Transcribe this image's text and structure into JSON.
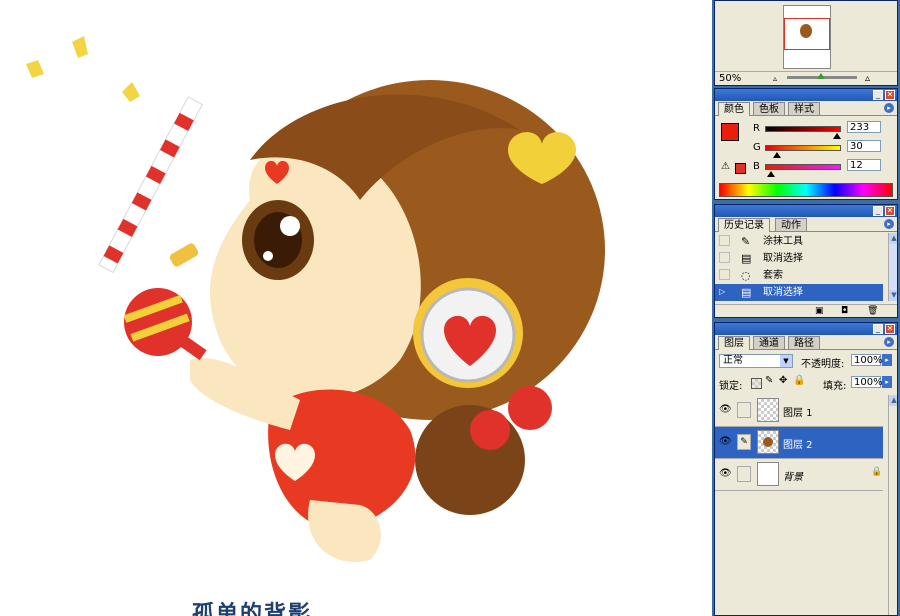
{
  "canvas": {
    "caption": "孤单的背影"
  },
  "navigator": {
    "zoom": "50%"
  },
  "color_panel": {
    "tabs": [
      "颜色",
      "色板",
      "样式"
    ],
    "channels": [
      {
        "label": "R",
        "value": "233"
      },
      {
        "label": "G",
        "value": "30"
      },
      {
        "label": "B",
        "value": "12"
      }
    ],
    "foreground": "#e91e0c",
    "warning_icon": "gamut-warning-icon"
  },
  "history_panel": {
    "tabs": [
      "历史记录",
      "动作"
    ],
    "items": [
      {
        "label": "涂抹工具",
        "icon": "smudge-icon",
        "selected": false
      },
      {
        "label": "取消选择",
        "icon": "document-icon",
        "selected": false
      },
      {
        "label": "套索",
        "icon": "lasso-icon",
        "selected": false
      },
      {
        "label": "取消选择",
        "icon": "document-icon",
        "selected": true
      }
    ]
  },
  "layers_panel": {
    "tabs": [
      "图层",
      "通道",
      "路径"
    ],
    "blend_mode": "正常",
    "opacity_label": "不透明度:",
    "opacity_value": "100%",
    "lock_label": "锁定:",
    "fill_label": "填充:",
    "fill_value": "100%",
    "layers": [
      {
        "name": "图层 1",
        "visible": true,
        "selected": false
      },
      {
        "name": "图层 2",
        "visible": true,
        "selected": true
      },
      {
        "name": "背景",
        "visible": true,
        "selected": false,
        "locked": true
      }
    ]
  },
  "colors": {
    "accent": "#2f63c2",
    "panel_bg": "#ece9d8",
    "titlebar": "#2357b5"
  }
}
